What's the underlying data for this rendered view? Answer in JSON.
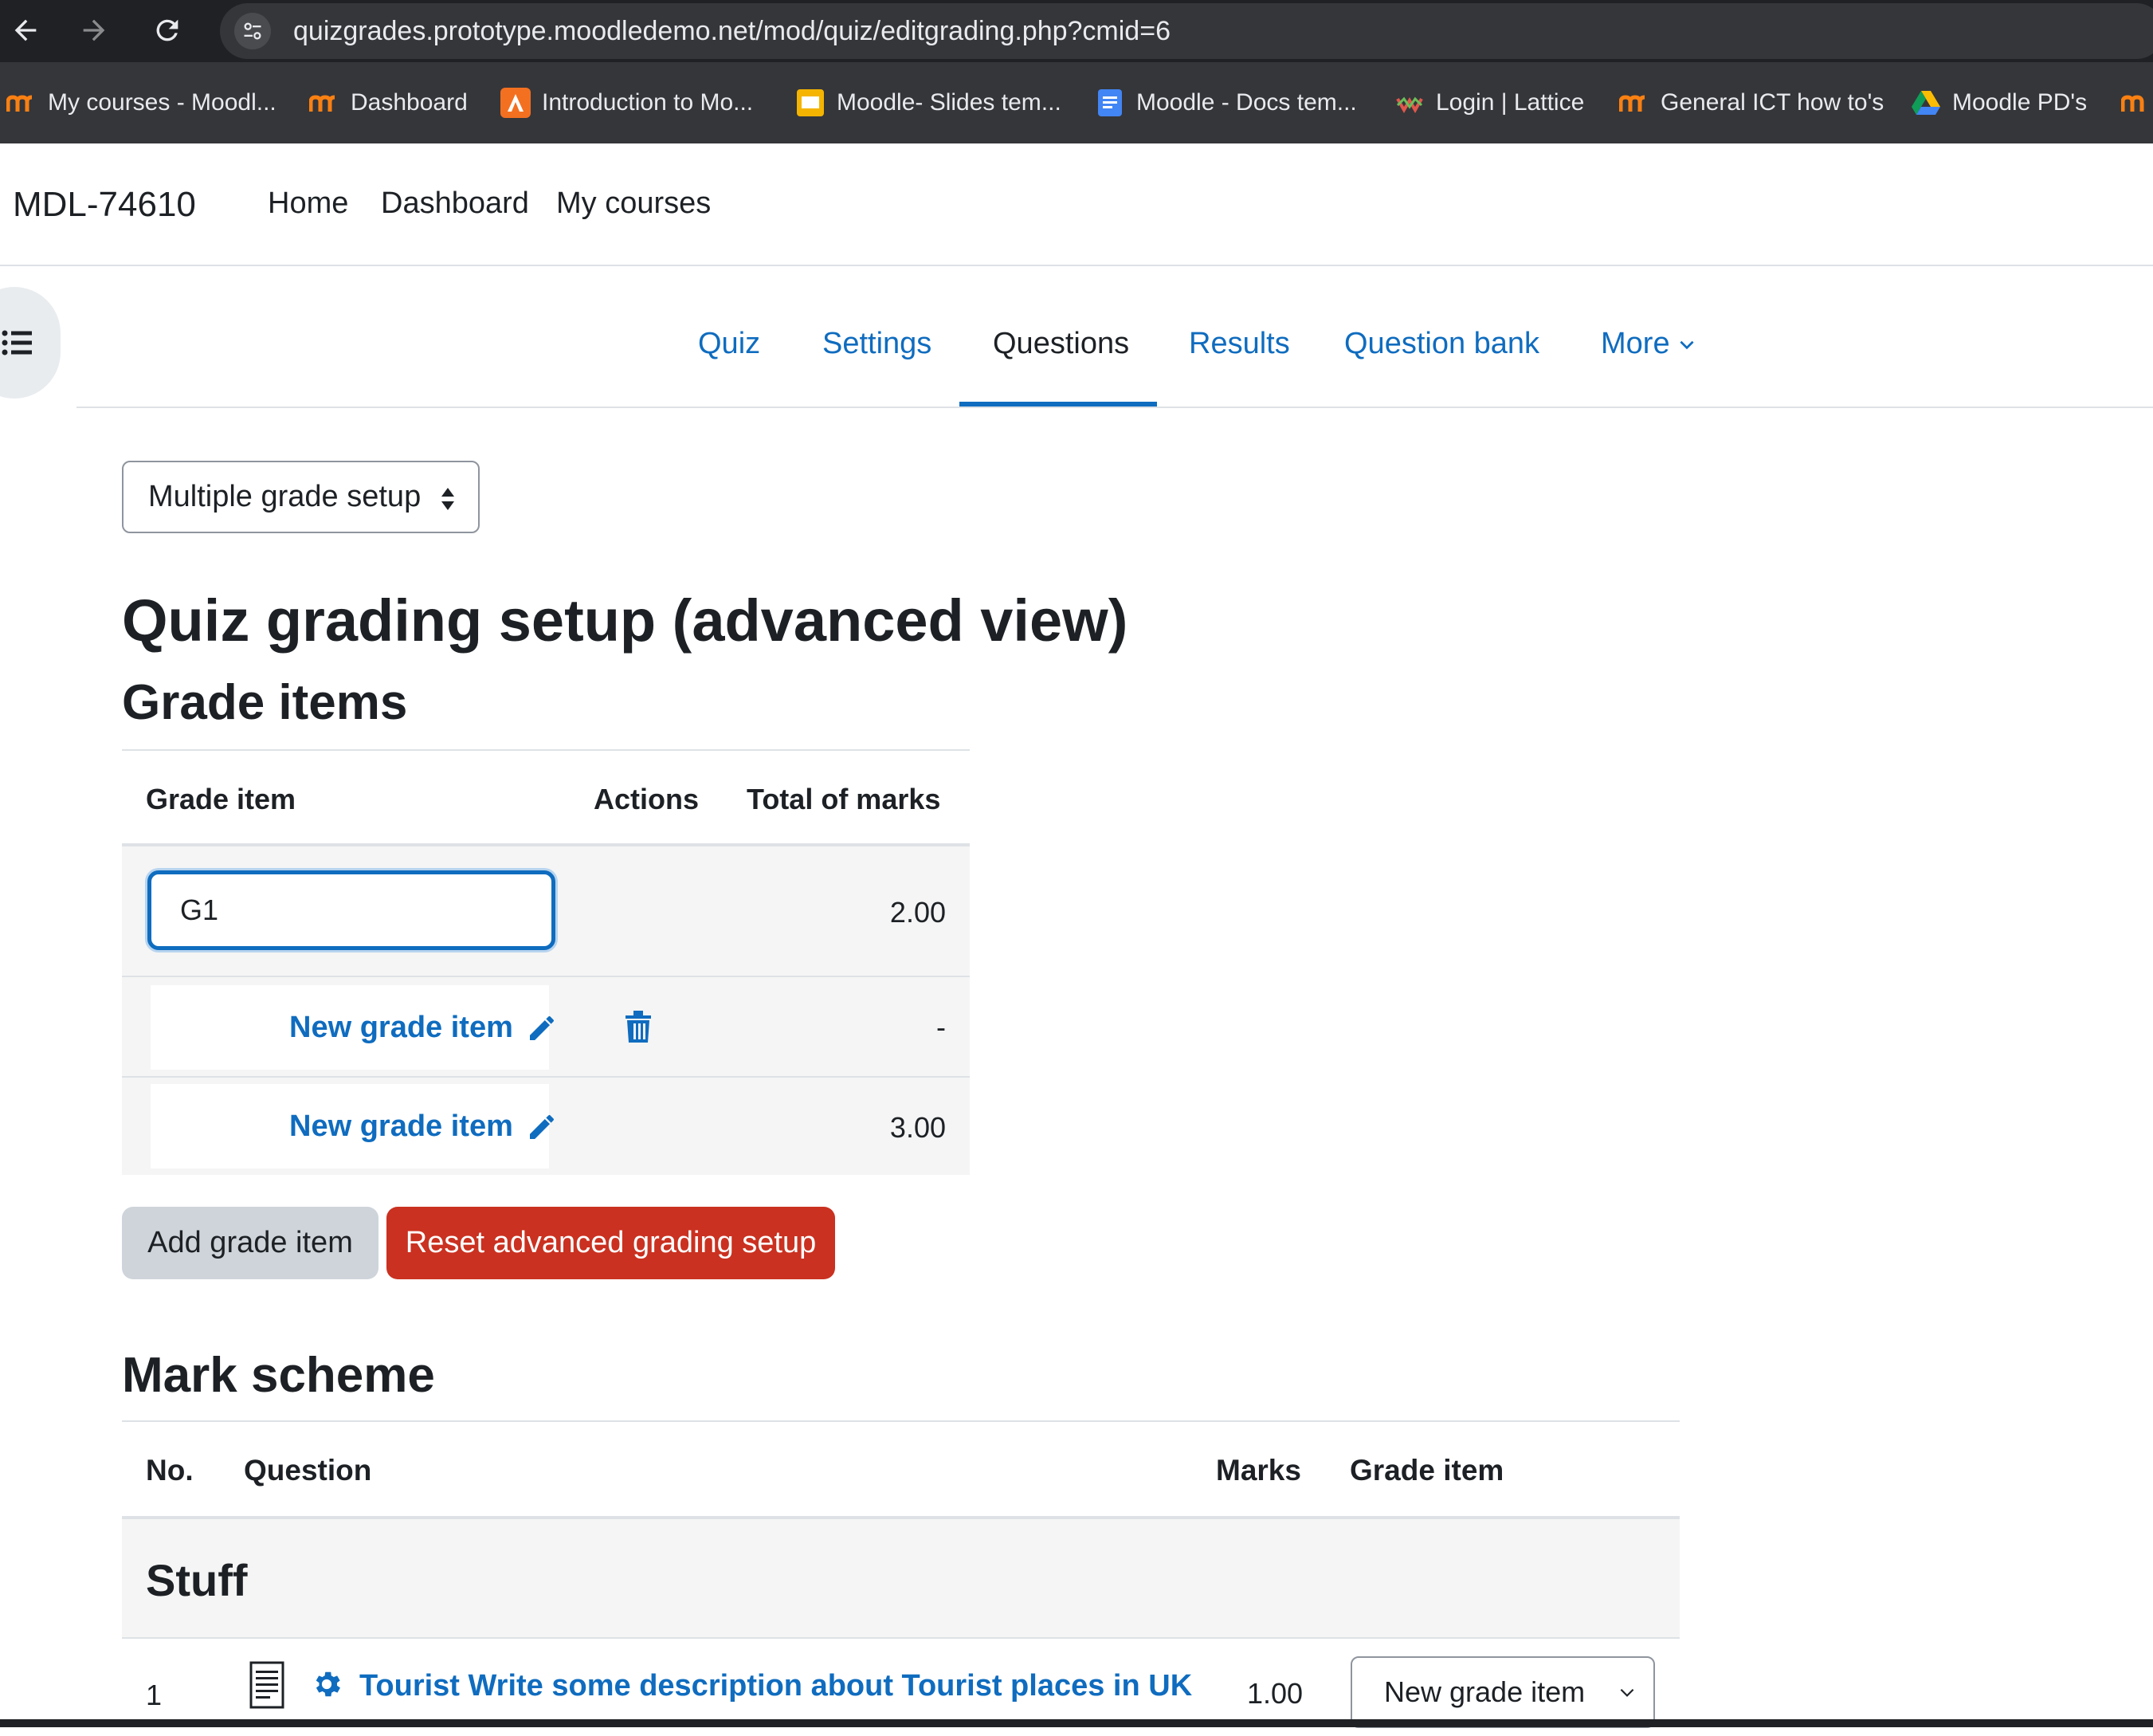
{
  "browser": {
    "url": "quizgrades.prototype.moodledemo.net/mod/quiz/editgrading.php?cmid=6",
    "bookmarks": [
      {
        "label": "My courses - Moodl...",
        "icon": "moodle-icon"
      },
      {
        "label": "Dashboard",
        "icon": "moodle-icon"
      },
      {
        "label": "Introduction to Mo...",
        "icon": "triangle-app-icon"
      },
      {
        "label": "Moodle- Slides tem...",
        "icon": "google-slides-icon"
      },
      {
        "label": "Moodle - Docs tem...",
        "icon": "google-docs-icon"
      },
      {
        "label": "Login | Lattice",
        "icon": "lattice-icon"
      },
      {
        "label": "General ICT how to's",
        "icon": "moodle-icon"
      },
      {
        "label": "Moodle PD's",
        "icon": "google-drive-icon"
      }
    ]
  },
  "navbar": {
    "site_name": "MDL-74610",
    "links": [
      "Home",
      "Dashboard",
      "My courses"
    ]
  },
  "secondary_nav": {
    "tabs": [
      "Quiz",
      "Settings",
      "Questions",
      "Results",
      "Question bank",
      "More"
    ],
    "active": "Questions"
  },
  "setup_select": {
    "value": "Multiple grade setup"
  },
  "page_title": "Quiz grading setup (advanced view)",
  "grade_items": {
    "heading": "Grade items",
    "columns": [
      "Grade item",
      "Actions",
      "Total of marks"
    ],
    "rows": [
      {
        "name": "G1",
        "editing": true,
        "total": "2.00"
      },
      {
        "name": "New grade item",
        "editing": false,
        "deletable": true,
        "total": "-"
      },
      {
        "name": "New grade item",
        "editing": false,
        "deletable": false,
        "total": "3.00"
      }
    ],
    "add_button": "Add grade item",
    "reset_button": "Reset advanced grading setup"
  },
  "mark_scheme": {
    "heading": "Mark scheme",
    "columns": [
      "No.",
      "Question",
      "Marks",
      "Grade item"
    ],
    "section": "Stuff",
    "questions": [
      {
        "no": "1",
        "name": "Tourist Write some description about Tourist places in UK",
        "marks": "1.00",
        "grade_item": "New grade item"
      }
    ]
  },
  "colors": {
    "link": "#0f6cbf",
    "danger": "#ca3120",
    "browser_bg": "#202124"
  }
}
